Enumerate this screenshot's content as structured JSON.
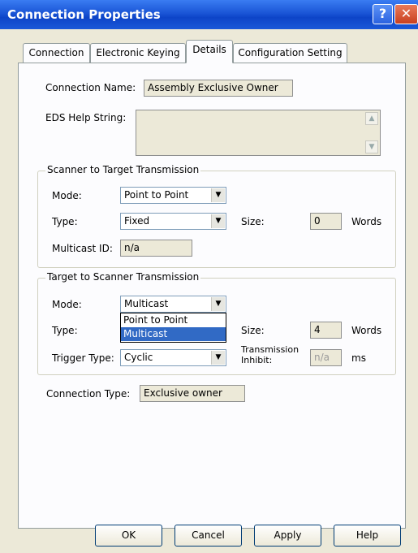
{
  "window": {
    "title": "Connection Properties",
    "help_glyph": "?",
    "close_glyph": "✕"
  },
  "tabs": [
    {
      "label": "Connection"
    },
    {
      "label": "Electronic Keying"
    },
    {
      "label": "Details",
      "active": true
    },
    {
      "label": "Configuration Setting"
    }
  ],
  "details": {
    "connection_name_label": "Connection Name:",
    "connection_name_value": "Assembly Exclusive Owner",
    "eds_help_label": "EDS Help String:",
    "eds_help_value": "",
    "scanner_to_target": {
      "title": "Scanner to Target Transmission",
      "mode_label": "Mode:",
      "mode_value": "Point to Point",
      "type_label": "Type:",
      "type_value": "Fixed",
      "size_label": "Size:",
      "size_value": "0",
      "size_unit": "Words",
      "multicast_id_label": "Multicast ID:",
      "multicast_id_value": "n/a"
    },
    "target_to_scanner": {
      "title": "Target to Scanner Transmission",
      "mode_label": "Mode:",
      "mode_value": "Multicast",
      "mode_options": [
        "Point to Point",
        "Multicast"
      ],
      "mode_highlighted": "Multicast",
      "type_label": "Type:",
      "size_label": "Size:",
      "size_value": "4",
      "size_unit": "Words",
      "trigger_type_label": "Trigger Type:",
      "trigger_type_value": "Cyclic",
      "transmission_inhibit_label_1": "Transmission",
      "transmission_inhibit_label_2": "Inhibit:",
      "transmission_inhibit_value": "n/a",
      "transmission_inhibit_unit": "ms"
    },
    "connection_type_label": "Connection Type:",
    "connection_type_value": "Exclusive owner"
  },
  "buttons": {
    "ok": "OK",
    "cancel": "Cancel",
    "apply": "Apply",
    "help": "Help"
  },
  "icons": {
    "dropdown_arrow": "▼",
    "scroll_up": "▲",
    "scroll_down": "▼"
  },
  "colors": {
    "titlebar": "#0d44c8",
    "dialog_bg": "#ece9d8",
    "selection": "#316ac5"
  }
}
